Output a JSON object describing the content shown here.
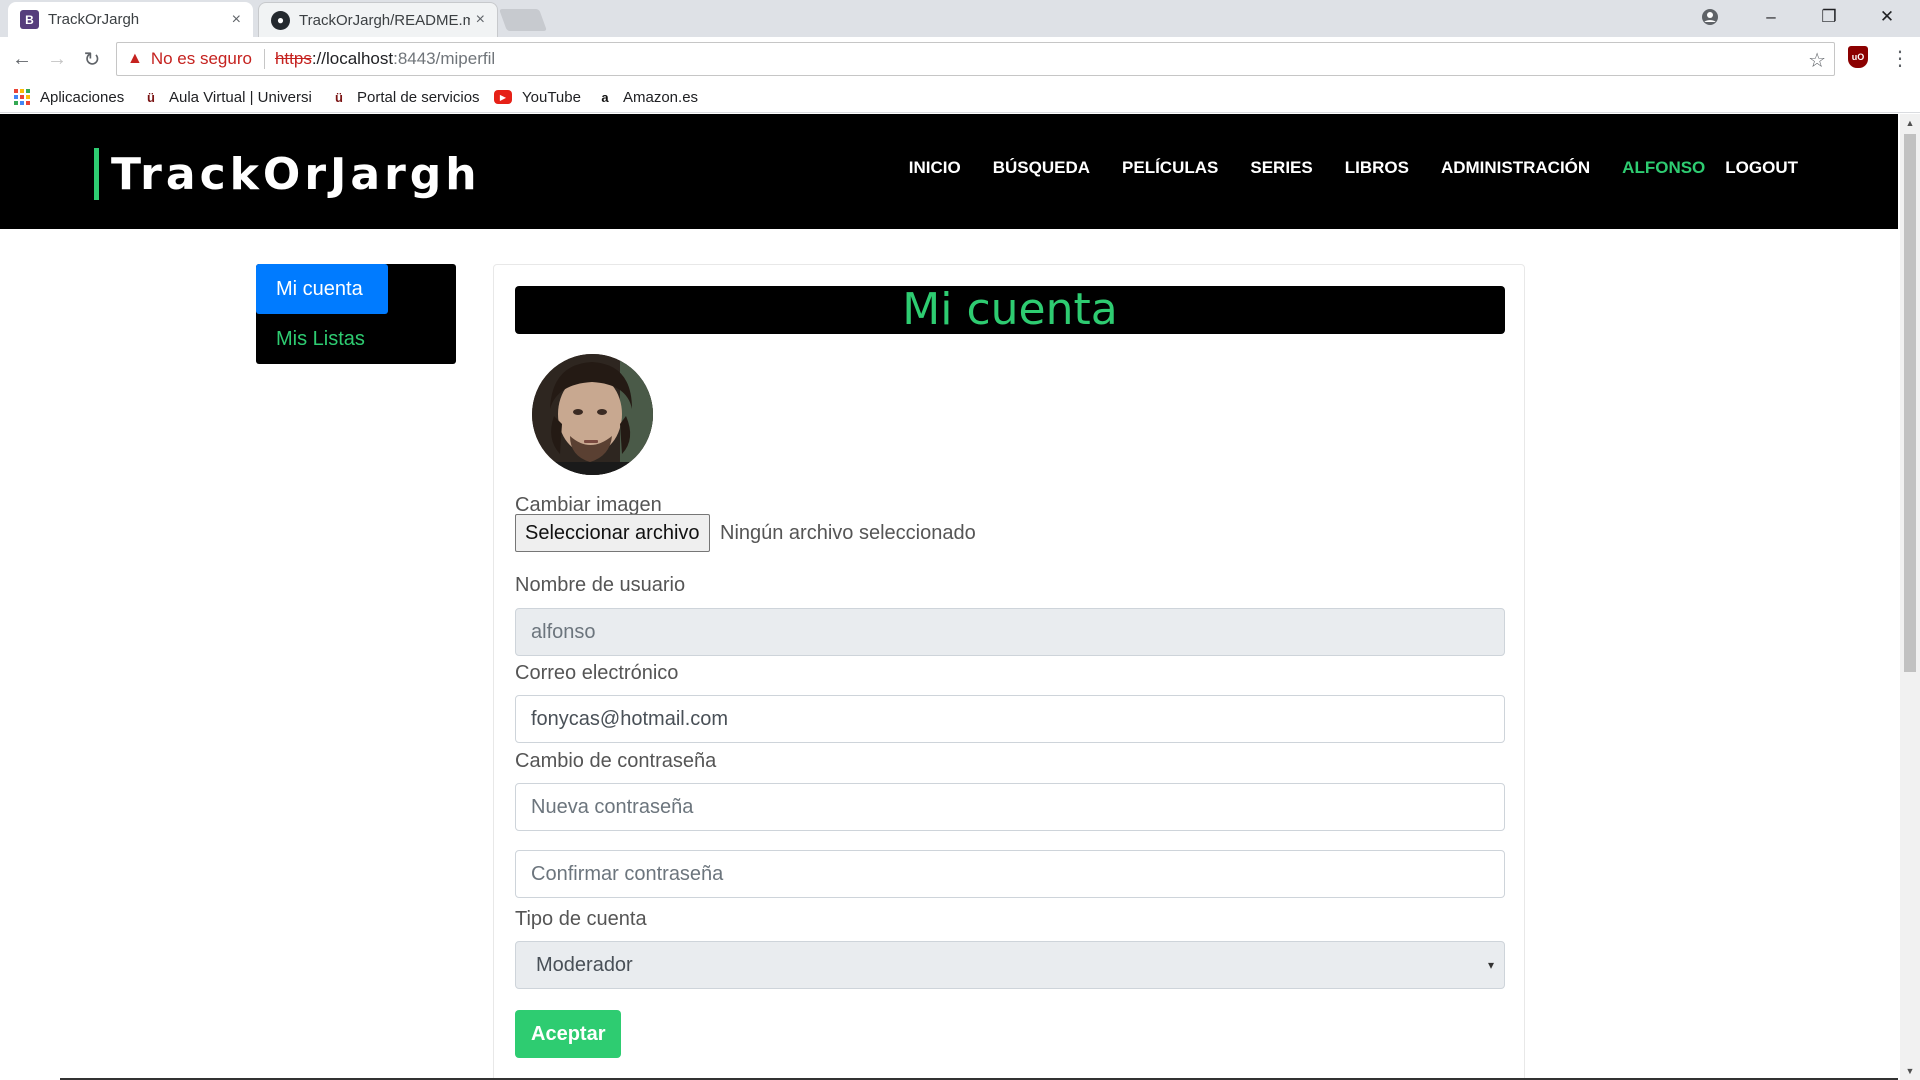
{
  "browser": {
    "tabs": [
      {
        "title": "TrackOrJargh",
        "favicon": "bootstrap-icon",
        "close": "×"
      },
      {
        "title": "TrackOrJargh/README.m",
        "favicon": "github-icon",
        "close": "×"
      }
    ],
    "address": {
      "security_label": "No es seguro",
      "scheme": "https",
      "host": "://localhost",
      "path": ":8443/miperfil"
    },
    "bookmarks": [
      "Aplicaciones",
      "Aula Virtual | Universi",
      "Portal de servicios",
      "YouTube",
      "Amazon.es"
    ]
  },
  "site": {
    "brand": "TrackOrJargh",
    "nav": [
      "INICIO",
      "BÚSQUEDA",
      "PELÍCULAS",
      "SERIES",
      "LIBROS",
      "ADMINISTRACIÓN",
      "ALFONSO",
      "LOGOUT"
    ],
    "accent_color": "#2ecc71",
    "active_color": "#007bff"
  },
  "sidebar": {
    "items": [
      {
        "label": "Mi cuenta",
        "active": true
      },
      {
        "label": "Mis Listas",
        "active": false
      }
    ]
  },
  "account": {
    "title": "Mi cuenta",
    "change_image_label": "Cambiar imagen",
    "file_button": "Seleccionar archivo",
    "file_status": "Ningún archivo seleccionado",
    "username_label": "Nombre de usuario",
    "username_value": "alfonso",
    "email_label": "Correo electrónico",
    "email_value": "fonycas@hotmail.com",
    "password_label": "Cambio de contraseña",
    "new_password_placeholder": "Nueva contraseña",
    "confirm_password_placeholder": "Confirmar contraseña",
    "account_type_label": "Tipo de cuenta",
    "account_type_value": "Moderador",
    "submit_label": "Aceptar"
  }
}
